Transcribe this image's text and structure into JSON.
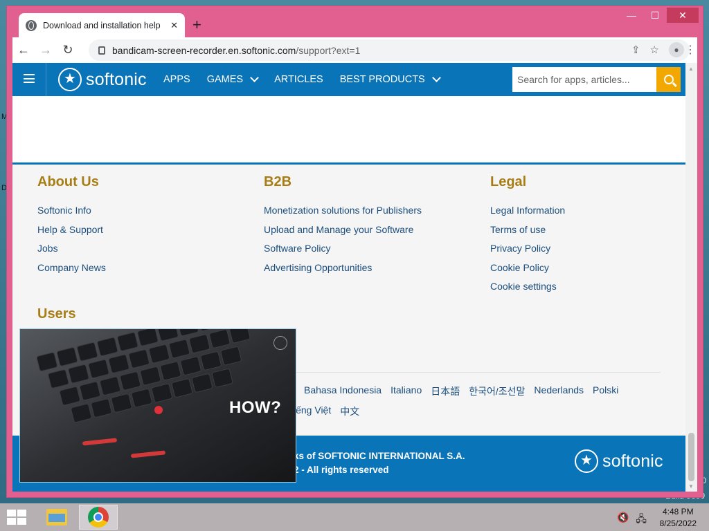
{
  "desktop": {
    "edge_chars": [
      "M",
      "D"
    ],
    "build_text": "Build 9600",
    "side_char": "0"
  },
  "window": {
    "controls": {
      "minimize": "—",
      "maximize": "☐",
      "close": "✕"
    }
  },
  "tab": {
    "title": "Download and installation help",
    "close": "✕",
    "new_tab": "+"
  },
  "toolbar": {
    "back": "←",
    "forward": "→",
    "reload": "↻",
    "url_host": "bandicam-screen-recorder.en.softonic.com",
    "url_path": "/support?ext=1",
    "share": "⇪",
    "star": "☆",
    "menu": "⋮"
  },
  "site": {
    "logo_text": "softonic",
    "nav": [
      {
        "label": "APPS",
        "dropdown": false
      },
      {
        "label": "GAMES",
        "dropdown": true
      },
      {
        "label": "ARTICLES",
        "dropdown": false
      },
      {
        "label": "BEST PRODUCTS",
        "dropdown": true
      }
    ],
    "search_placeholder": "Search for apps, articles..."
  },
  "footer": {
    "columns": [
      {
        "heading": "About Us",
        "links": [
          "Softonic Info",
          "Help & Support",
          "Jobs",
          "Company News"
        ]
      },
      {
        "heading": "B2B",
        "links": [
          "Monetization solutions for Publishers",
          "Upload and Manage your Software",
          "Software Policy",
          "Advertising Opportunities"
        ]
      },
      {
        "heading": "Legal",
        "links": [
          "Legal Information",
          "Terms of use",
          "Privacy Policy",
          "Cookie Policy",
          "Cookie settings"
        ]
      }
    ],
    "users_heading": "Users",
    "languages_row1": [
      "Bahasa Indonesia",
      "Italiano",
      "日本語",
      "한국어/조선말",
      "Nederlands",
      "Polski"
    ],
    "languages_row2": [
      "iếng Việt",
      "中文"
    ],
    "copyright_line1": "ks of SOFTONIC INTERNATIONAL S.A.",
    "copyright_line2": "2 - All rights reserved",
    "logo_text": "softonic"
  },
  "video": {
    "overlay_text": "HOW?"
  },
  "taskbar": {
    "clock_time": "4:48 PM",
    "clock_date": "8/25/2022"
  }
}
